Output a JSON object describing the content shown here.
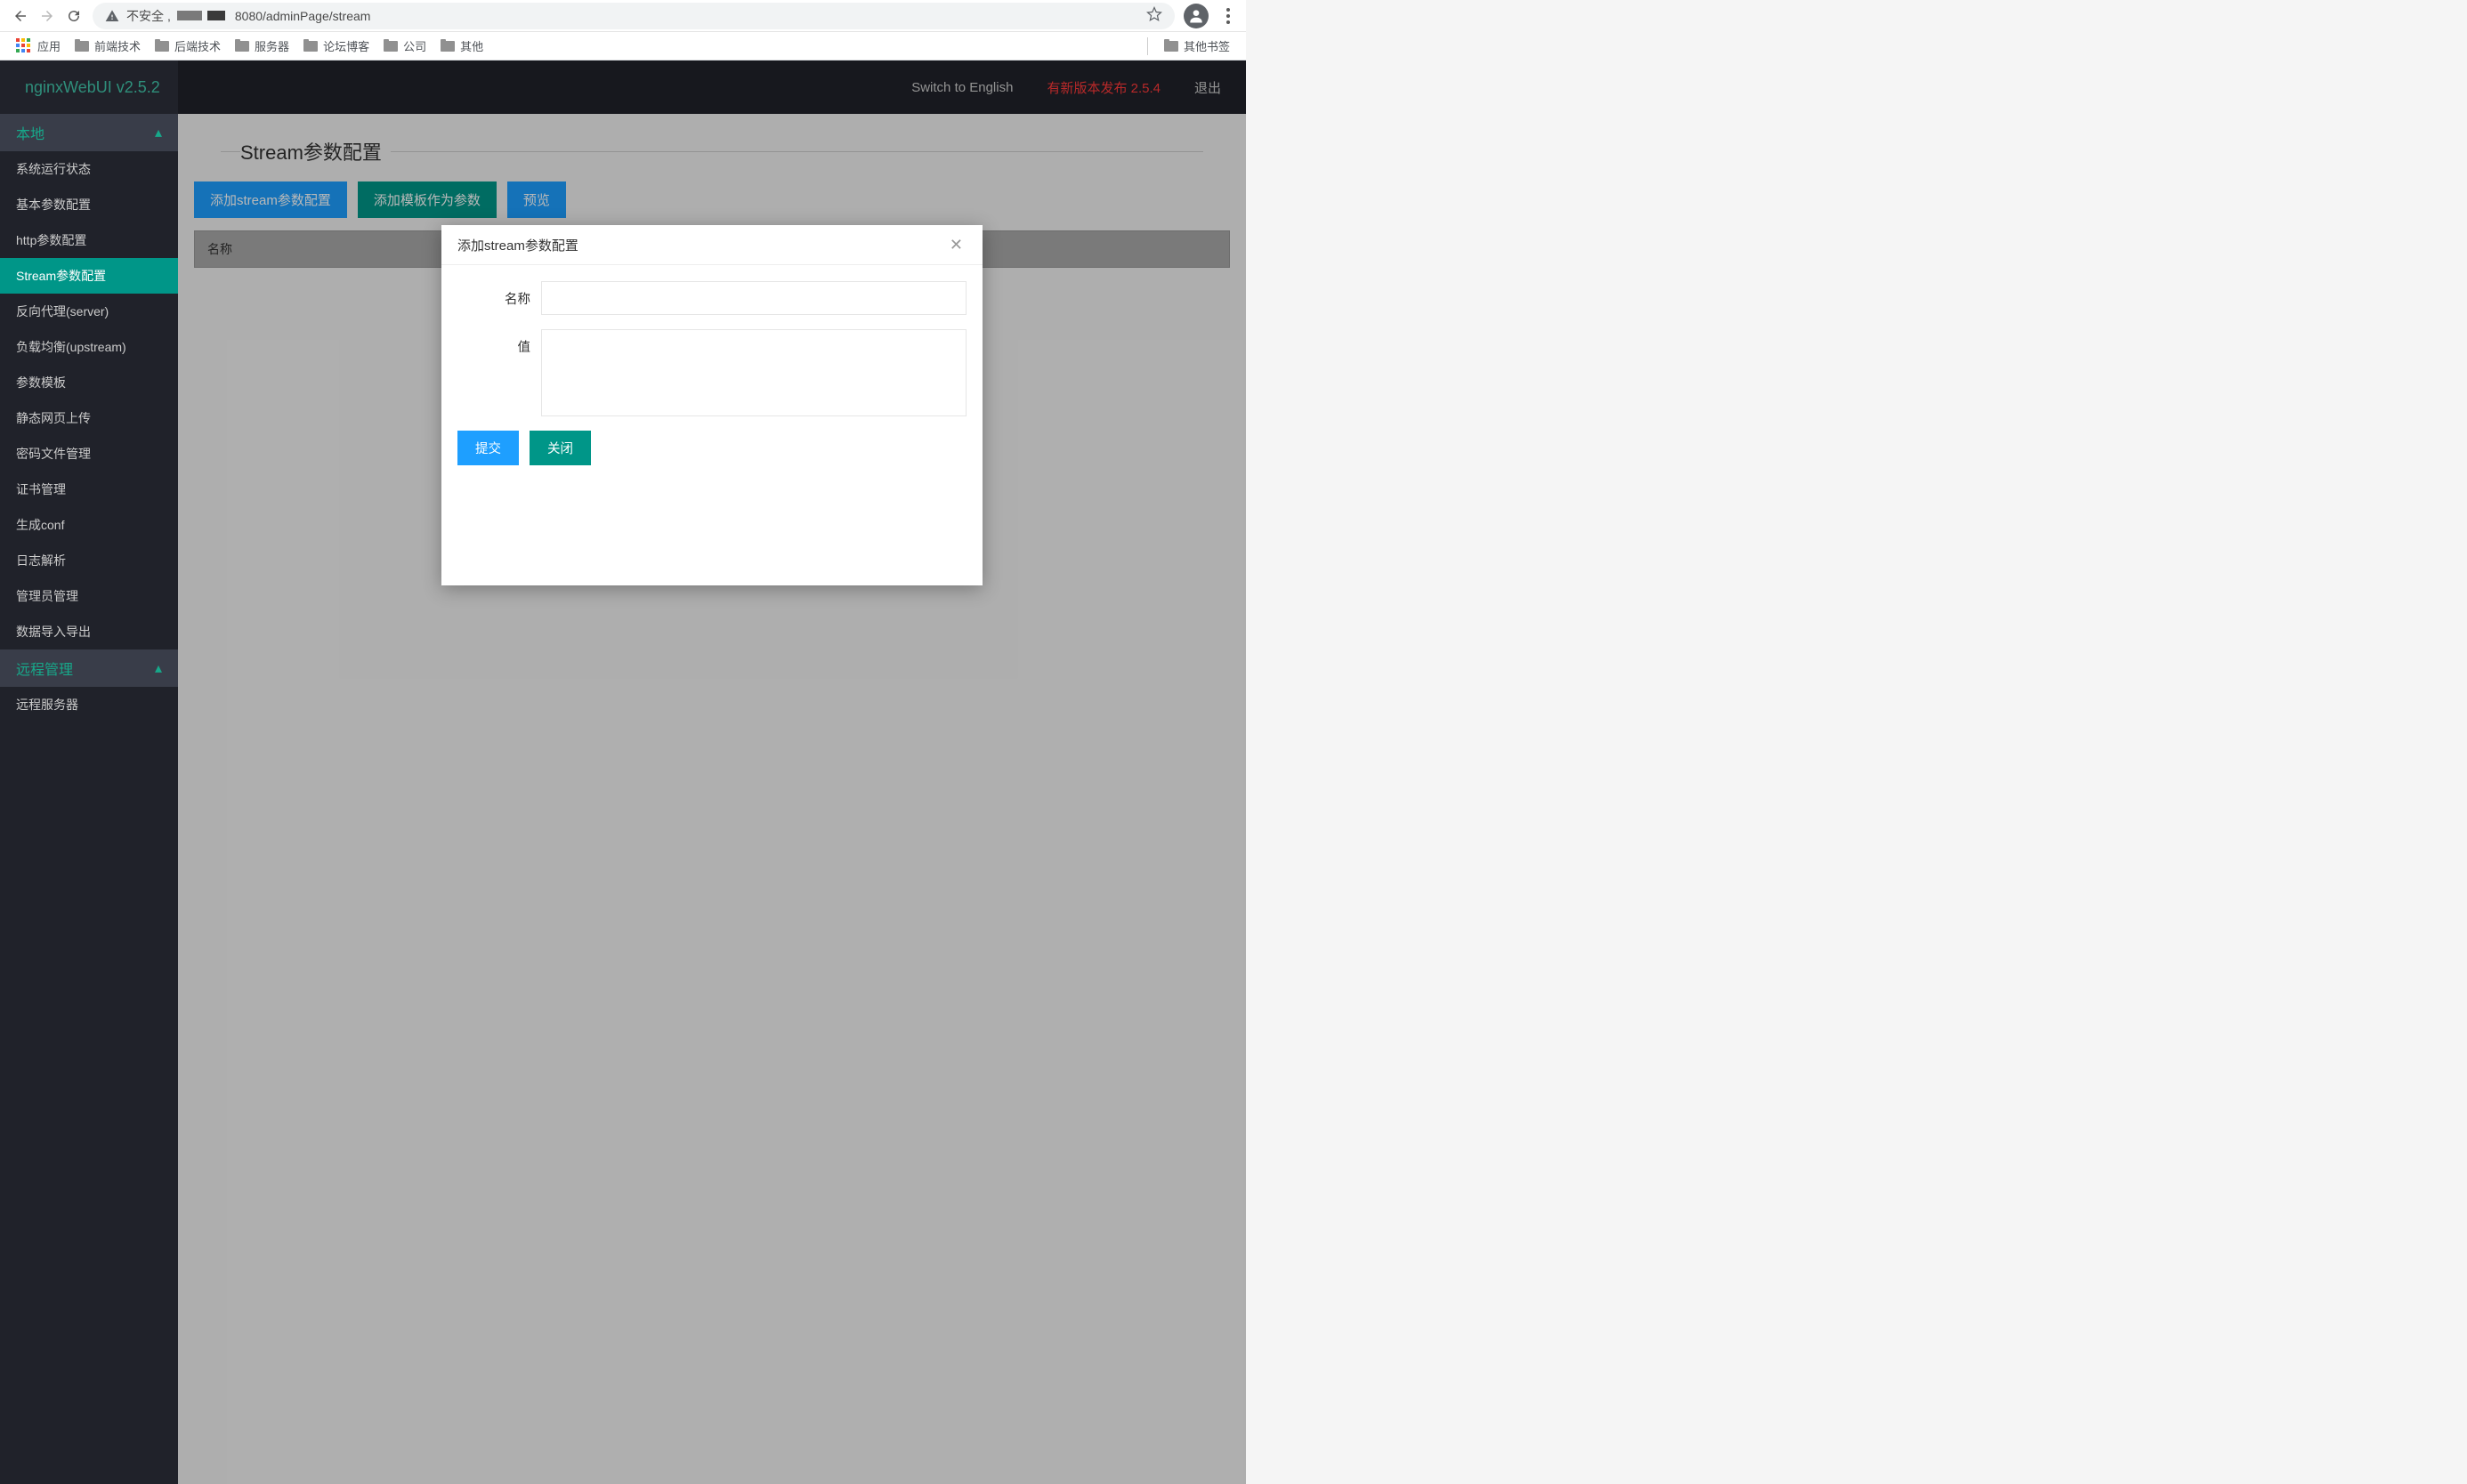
{
  "browser": {
    "insecure": "不安全",
    "url_suffix": "8080/adminPage/stream"
  },
  "bookmarks": {
    "apps": "应用",
    "items": [
      "前端技术",
      "后端技术",
      "服务器",
      "论坛博客",
      "公司",
      "其他"
    ],
    "other": "其他书签"
  },
  "header": {
    "brand": "nginxWebUI v2.5.2",
    "switch": "Switch to English",
    "new_version": "有新版本发布 2.5.4",
    "logout": "退出"
  },
  "sidebar": {
    "local": "本地",
    "items": [
      "系统运行状态",
      "基本参数配置",
      "http参数配置",
      "Stream参数配置",
      "反向代理(server)",
      "负载均衡(upstream)",
      "参数模板",
      "静态网页上传",
      "密码文件管理",
      "证书管理",
      "生成conf",
      "日志解析",
      "管理员管理",
      "数据导入导出"
    ],
    "remote": "远程管理",
    "remote_item": "远程服务器"
  },
  "page": {
    "title": "Stream参数配置",
    "add_stream": "添加stream参数配置",
    "add_template": "添加模板作为参数",
    "preview": "预览",
    "col_name": "名称"
  },
  "modal": {
    "title": "添加stream参数配置",
    "label_name": "名称",
    "label_value": "值",
    "submit": "提交",
    "close": "关闭"
  }
}
